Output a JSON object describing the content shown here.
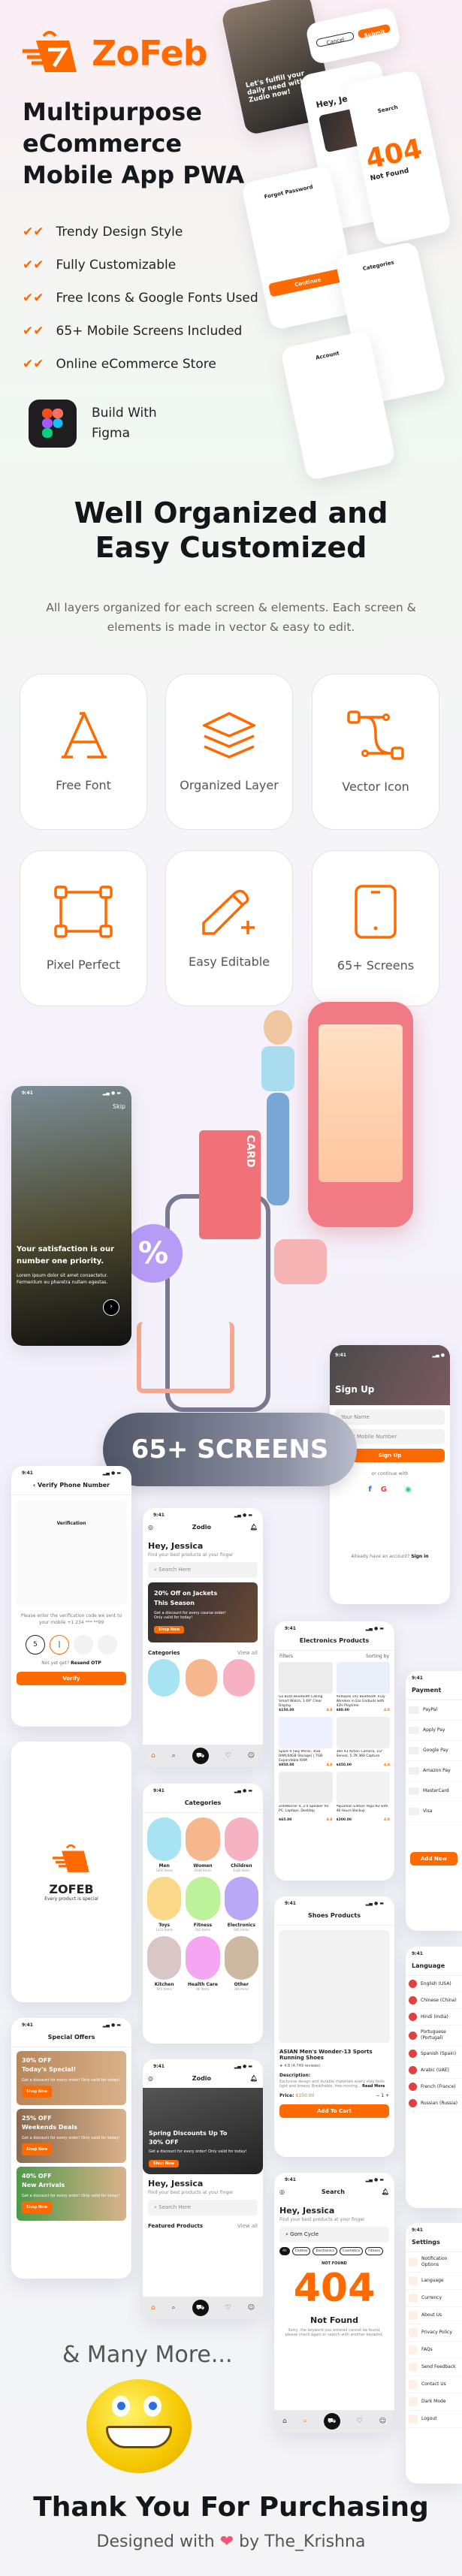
{
  "brand": {
    "name": "ZoFeb",
    "color": "#ff6a00"
  },
  "hero": {
    "title_lines": [
      "Multipurpose",
      "eCommerce",
      "Mobile App PWA"
    ],
    "bullets": [
      "Trendy Design Style",
      "Fully Customizable",
      "Free Icons & Google Fonts Used",
      "65+ Mobile Screens Included",
      "Online eCommerce Store"
    ],
    "figma_line1": "Build With",
    "figma_line2": "Figma"
  },
  "collage": {
    "onboard": "Let's fulfill your daily need with Zudio now!",
    "forgot": "Forgot Password",
    "forgot_btn": "Continue",
    "home": "Hey, Jessica",
    "categories": "Categories",
    "account": "Account",
    "search": "Search",
    "notfound": "Not Found",
    "cancel": "Cancel",
    "submit": "Submit"
  },
  "section2": {
    "title_line1": "Well Organized and",
    "title_line2": "Easy Customized",
    "subtitle": "All layers organized for each screen & elements. Each screen & elements is made in vector & easy to edit.",
    "features": [
      {
        "label": "Free Font",
        "icon": "font-icon"
      },
      {
        "label": "Organized Layer",
        "icon": "layers-icon"
      },
      {
        "label": "Vector Icon",
        "icon": "vector-icon"
      },
      {
        "label": "Pixel Perfect",
        "icon": "pixel-frame-icon"
      },
      {
        "label": "Easy Editable",
        "icon": "pencil-plus-icon"
      },
      {
        "label": "65+ Screens",
        "icon": "phone-icon"
      }
    ]
  },
  "illustration": {
    "card_text": "CARD"
  },
  "screens_badge": "65+ SCREENS",
  "screens": {
    "time": "9:41",
    "onboarding": {
      "skip": "Skip",
      "title": "Your satisfaction is our number one priority.",
      "body": "Lorem ipsum dolor sit amet consectetur. Fermentum eu pharetra nullam egestas."
    },
    "signup": {
      "title": "Sign Up",
      "name_ph": "Your Name",
      "mobile_ph": "Enter Mobile Number",
      "button": "Sign Up",
      "or": "or continue with",
      "already": "Already have an account?",
      "signin": "Sign in"
    },
    "verify": {
      "title": "Verify Phone Number",
      "illus": "Verification",
      "text": "Please enter the verification code we sent to your mobile +1 234 *** **99",
      "otp": [
        "5",
        "|",
        "",
        ""
      ],
      "notyet": "Not yet get?",
      "resend": "Resend OTP",
      "button": "Verify"
    },
    "home": {
      "app": "Zodio",
      "hey": "Hey, Jessica",
      "find": "Find your best products at your finger",
      "search_ph": "Search Here",
      "banner_title": "20% Off on Jackets This Season",
      "banner_body": "Get a discount for every course order! Only valid for today!",
      "shop": "Shop Now",
      "categories": "Categories",
      "view_all": "View all"
    },
    "electronics": {
      "title": "Electronics Products",
      "filters": "Filters",
      "sorting": "Sorting by",
      "products": [
        {
          "name": "Go Buzz Bluetooth Calling Smart Watch, 1.69\" Clear Display",
          "price": "$150.00",
          "rating": "4.8"
        },
        {
          "name": "Airdopes 141 Bluetooth Truly Wireless in Ear Earbuds with 42H Playtime",
          "price": "$80.00",
          "rating": "4.8"
        },
        {
          "name": "Spark 9 (Sky Mirror, 4GB RAM,64GB Storage) | 7GB Expandable RAM",
          "price": "$850.00",
          "rating": "4.8"
        },
        {
          "name": "360 X3 Action Camera, 1/2\" Sensor, 5.7K 360 Capture",
          "price": "$450.00",
          "rating": "4.8"
        },
        {
          "name": "ZebWarrior 4, 2.0 Speaker for PC, Laptops, Desktop",
          "price": "$65.00",
          "rating": "4.8"
        },
        {
          "name": "Aquaman Edition Yoga N3 with 46 Hours Backup",
          "price": "$200.00",
          "rating": "4.8"
        }
      ]
    },
    "payment": {
      "title": "Payment",
      "methods": [
        "PayPal",
        "Apply Pay",
        "Google Pay",
        "Amazon Pay",
        "MasterCard",
        "Visa"
      ],
      "button": "Add New"
    },
    "splash": {
      "name": "ZOFEB",
      "tagline": "Every product is special"
    },
    "categories": {
      "title": "Categories",
      "items": [
        {
          "name": "Men",
          "count": "1856 Items"
        },
        {
          "name": "Women",
          "count": "2648 Items"
        },
        {
          "name": "Children",
          "count": "3246 Items"
        },
        {
          "name": "Toys",
          "count": "1423 Items"
        },
        {
          "name": "Fitness",
          "count": "562 Items"
        },
        {
          "name": "Electronics",
          "count": "845 Items"
        },
        {
          "name": "Kitchen",
          "count": "845 Items"
        },
        {
          "name": "Health Care",
          "count": "89 Items"
        },
        {
          "name": "Other",
          "count": "286 Items"
        }
      ]
    },
    "shoes": {
      "title": "Shoes Products",
      "name": "ASIAN Men's Wonder-13 Sports Running Shoes",
      "rating": "4.8 (4,749 reviews)",
      "desc_label": "Description:",
      "desc": "Exclusive design and durable materials every step feels light and breezy. Breathable, free-moving...",
      "read_more": "Read More",
      "price_label": "Price:",
      "price": "$150.00",
      "qty": "1",
      "button": "Add To Cart"
    },
    "language": {
      "title": "Language",
      "items": [
        "English (USA)",
        "Chinese (China)",
        "Hindi (India)",
        "Portuguese (Portugal)",
        "Spanish (Spain)",
        "Arabic (UAE)",
        "French (France)",
        "Russian (Russia)"
      ]
    },
    "offers": {
      "title": "Special Offers",
      "items": [
        {
          "pct": "30% OFF",
          "name": "Today's Special!",
          "color": "#b8865a"
        },
        {
          "pct": "25% OFF",
          "name": "Weekends Deals",
          "color": "#8a6a50"
        },
        {
          "pct": "40% OFF",
          "name": "New Arrivals",
          "color": "#4f9a4a"
        }
      ],
      "body": "Get a discount for every order! Only valid for today!",
      "shop": "Shop Now"
    },
    "home2": {
      "banner_title": "Spring Discounts Up To 30% OFF",
      "banner_body": "Get a discount for every order! Only valid for today!",
      "featured": "Featured Products"
    },
    "search": {
      "title": "Search",
      "query": "Gom Cycle",
      "chips": [
        "All",
        "Clothes",
        "Electronics",
        "Cosmetics",
        "Fitness"
      ],
      "nf_small": "NOT FOUND",
      "code": "404",
      "nf": "Not Found",
      "nf_text": "Sorry, the keyword you entered cannot be found, please check again or search with another keyword."
    },
    "settings": {
      "title": "Settings",
      "items": [
        "Notification Options",
        "Language",
        "Currency",
        "About Us",
        "Privacy Policy",
        "FAQs",
        "Send Feedback",
        "Contact Us",
        "Dark Mode",
        "Logout"
      ]
    }
  },
  "footer": {
    "many_more": "& Many More...",
    "thanks": "Thank You For Purchasing",
    "designed": "Designed with",
    "by": "by The_Krishna"
  }
}
